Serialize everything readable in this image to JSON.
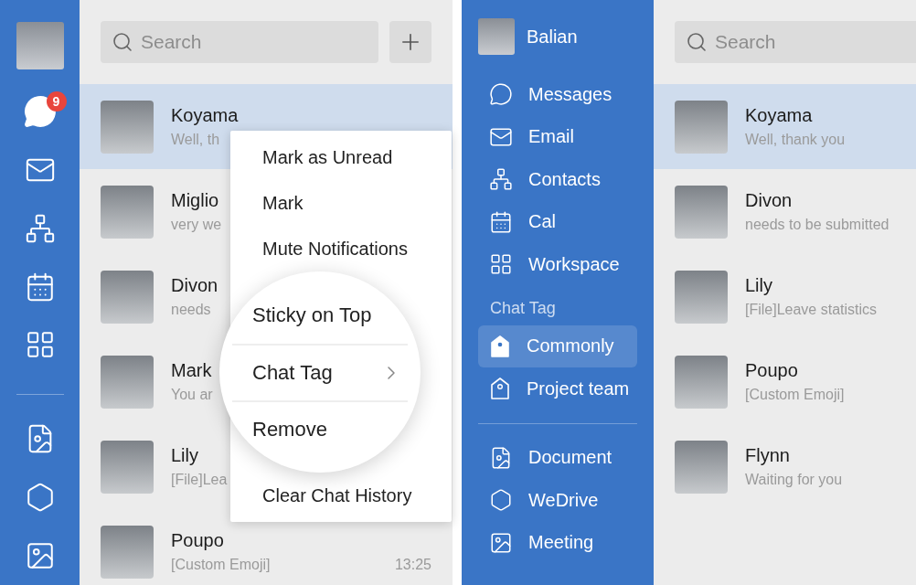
{
  "left": {
    "rail": {
      "items": [
        {
          "kind": "messages",
          "selected": true,
          "badge": "9"
        },
        {
          "kind": "email",
          "selected": false
        },
        {
          "kind": "contacts",
          "selected": false
        },
        {
          "kind": "calendar",
          "selected": false
        },
        {
          "kind": "workspace",
          "selected": false
        }
      ],
      "apps": [
        {
          "kind": "document"
        },
        {
          "kind": "drive"
        },
        {
          "kind": "meeting"
        }
      ]
    },
    "search": {
      "placeholder": "Search"
    },
    "chats": [
      {
        "name": "Koyama",
        "preview": "Well, th",
        "selected": true
      },
      {
        "name": "Miglio",
        "preview": "very we",
        "selected": false
      },
      {
        "name": "Divon",
        "preview": "needs",
        "selected": false
      },
      {
        "name": "Mark",
        "preview": "You ar",
        "selected": false
      },
      {
        "name": "Lily",
        "preview": "[File]Lea",
        "selected": false
      },
      {
        "name": "Poupo",
        "preview": "[Custom Emoji]",
        "time": "13:25",
        "selected": false
      }
    ],
    "context_menu": {
      "top_items": [
        {
          "label": "Mark as Unread"
        },
        {
          "label": "Mark"
        },
        {
          "label": "Mute Notifications"
        }
      ],
      "magnified_items": [
        {
          "label": "Sticky on Top",
          "submenu": false
        },
        {
          "label": "Chat Tag",
          "submenu": true
        },
        {
          "label": "Remove",
          "submenu": false
        }
      ],
      "bottom_items": [
        {
          "label": "Clear Chat History"
        }
      ]
    }
  },
  "right": {
    "profile": {
      "name": "Balian"
    },
    "nav": [
      {
        "kind": "messages",
        "label": "Messages",
        "selected": false
      },
      {
        "kind": "email",
        "label": "Email",
        "selected": false
      },
      {
        "kind": "contacts",
        "label": "Contacts",
        "selected": false
      },
      {
        "kind": "calendar",
        "label": "Cal",
        "selected": false
      },
      {
        "kind": "workspace",
        "label": "Workspace",
        "selected": false
      }
    ],
    "tag_section": {
      "title": "Chat Tag",
      "items": [
        {
          "label": "Commonly",
          "selected": true
        },
        {
          "label": "Project team",
          "selected": false
        }
      ]
    },
    "apps": [
      {
        "kind": "document",
        "label": "Document"
      },
      {
        "kind": "drive",
        "label": "WeDrive"
      },
      {
        "kind": "meeting",
        "label": "Meeting"
      }
    ],
    "search": {
      "placeholder": "Search"
    },
    "chats": [
      {
        "name": "Koyama",
        "preview": "Well, thank you",
        "selected": true
      },
      {
        "name": "Divon",
        "preview": "needs to be submitted",
        "selected": false
      },
      {
        "name": "Lily",
        "preview": "[File]Leave statistics",
        "selected": false
      },
      {
        "name": "Poupo",
        "preview": "[Custom Emoji]",
        "selected": false
      },
      {
        "name": "Flynn",
        "preview": "Waiting for you",
        "selected": false
      }
    ]
  }
}
